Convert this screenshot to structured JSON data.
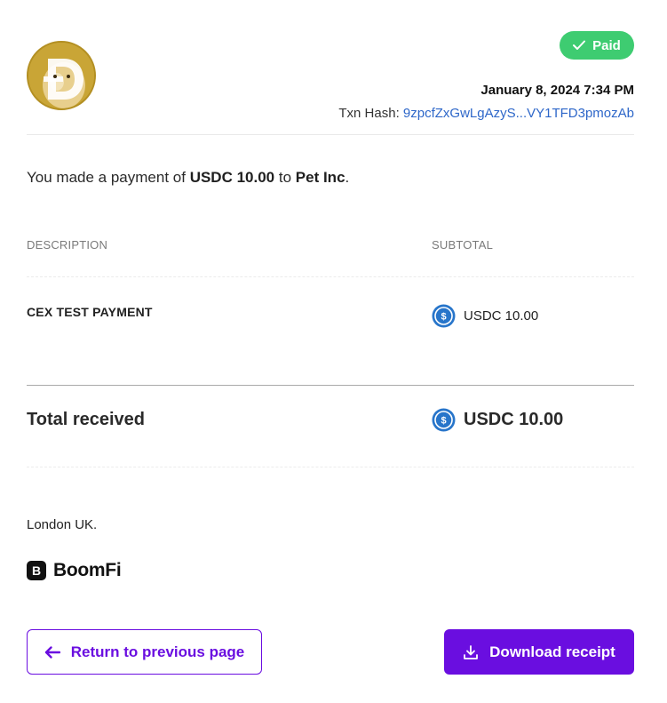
{
  "header": {
    "avatar_icon": "doge-logo-icon",
    "status_label": "Paid",
    "status_color": "#3ecc71",
    "date": "January 8, 2024 7:34 PM",
    "txn_hash_label": "Txn Hash:",
    "txn_hash_value": "9zpcfZxGwLgAzyS...VY1TFD3pmozAb"
  },
  "summary": {
    "prefix": "You made a payment of",
    "amount": "USDC 10.00",
    "middle": "to",
    "recipient": "Pet Inc",
    "suffix": "."
  },
  "table": {
    "columns": [
      "DESCRIPTION",
      "SUBTOTAL"
    ],
    "rows": [
      {
        "description": "CEX TEST PAYMENT",
        "subtotal": "USDC 10.00",
        "icon": "usdc-coin-icon"
      }
    ]
  },
  "total": {
    "label": "Total received",
    "value": "USDC 10.00",
    "icon": "usdc-coin-icon"
  },
  "footer": {
    "address": "London UK.",
    "brand_mark": "B",
    "brand_name": "BoomFi"
  },
  "actions": {
    "back_label": "Return to previous page",
    "download_label": "Download receipt",
    "accent_color": "#6a0ee0"
  }
}
